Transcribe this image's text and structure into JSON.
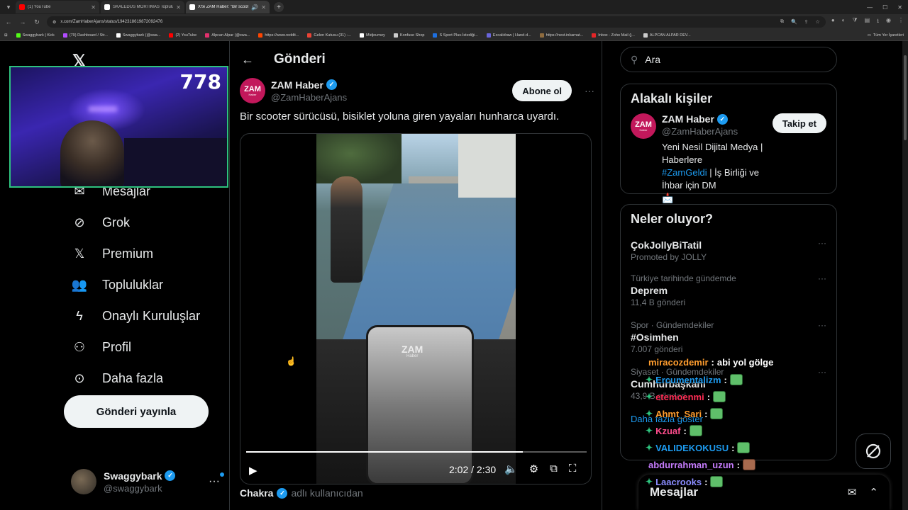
{
  "browser": {
    "tabs": [
      {
        "title": "(1) YouTube",
        "fav": "#ff0000",
        "active": false
      },
      {
        "title": "SKALEDUS MORTIMAS Topluluk",
        "fav": "#ffffff",
        "active": false
      },
      {
        "title": "X'te ZAM Haber: \"Bir scoot",
        "fav": "#ffffff",
        "active": true
      }
    ],
    "url": "x.com/ZamHaberAjans/status/1942318619872092476",
    "bookmarks": [
      {
        "label": "Swaggybark | Kick",
        "color": "#53fc18"
      },
      {
        "label": "(79) Dashboard / Str...",
        "color": "#b14cff"
      },
      {
        "label": "Swaggybark (@swa...",
        "color": "#ffffff"
      },
      {
        "label": "(2) YouTube",
        "color": "#ff0000"
      },
      {
        "label": "Alpcan Alpar (@swa...",
        "color": "#e1306c"
      },
      {
        "label": "https://www.reddit...",
        "color": "#ff4500"
      },
      {
        "label": "Gelen Kutusu (31) -...",
        "color": "#ea4335"
      },
      {
        "label": "Midjourney",
        "color": "#ffffff"
      },
      {
        "label": "Konfuse Shop",
        "color": "#cccccc"
      },
      {
        "label": "S Sport Plus-İstediği...",
        "color": "#1d6fe0"
      },
      {
        "label": "Excalidraw | Hand-d...",
        "color": "#6965db"
      },
      {
        "label": "https://nest.inkarnat...",
        "color": "#8e6b3e"
      },
      {
        "label": "Inbox - Zoho Mail (j...",
        "color": "#e42527"
      },
      {
        "label": "ALPCAN ALPAR DEV...",
        "color": "#cccccc"
      }
    ],
    "all_bookmarks": "Tüm Yer İşaretleri"
  },
  "webcam": {
    "count": "778"
  },
  "nav": {
    "items": [
      {
        "label": "Mesajlar",
        "icon": "envelope-icon"
      },
      {
        "label": "Grok",
        "icon": "grok-icon"
      },
      {
        "label": "Premium",
        "icon": "x-logo-icon"
      },
      {
        "label": "Topluluklar",
        "icon": "people-icon"
      },
      {
        "label": "Onaylı Kuruluşlar",
        "icon": "lightning-icon"
      },
      {
        "label": "Profil",
        "icon": "person-icon"
      },
      {
        "label": "Daha fazla",
        "icon": "more-circle-icon"
      }
    ],
    "post_button": "Gönderi yayınla",
    "account": {
      "name": "Swaggybark",
      "handle": "@swaggybark"
    }
  },
  "main": {
    "title": "Gönderi",
    "author": {
      "name": "ZAM Haber",
      "handle": "@ZamHaberAjans",
      "avatar_text": "ZAM",
      "avatar_sub": "Haber"
    },
    "subscribe": "Abone ol",
    "text": "Bir scooter sürücüsü, bisiklet yoluna giren yayaları hunharca uyardı.",
    "video": {
      "time": "2:02 / 2:30",
      "progress": 0.8133,
      "watermark": "ZAM",
      "watermark_sub": "Haber"
    },
    "community": {
      "name": "Chakra",
      "suffix": "adlı kullanıcıdan"
    }
  },
  "right": {
    "search_placeholder": "Ara",
    "related_title": "Alakalı kişiler",
    "related": {
      "name": "ZAM Haber",
      "handle": "@ZamHaberAjans",
      "follow": "Takip et",
      "bio_1": "Yeni Nesil Dijital Medya | Haberlere",
      "bio_tag": "#ZamGeldi",
      "bio_2": " | İş Birliği ve İhbar için DM",
      "bio_3": "📩"
    },
    "trends_title": "Neler oluyor?",
    "trends": [
      {
        "cat": "",
        "name": "ÇokJollyBiTatil",
        "meta": "Promoted by JOLLY"
      },
      {
        "cat": "Türkiye tarihinde gündemde",
        "name": "Deprem",
        "meta": "11,4 B gönderi"
      },
      {
        "cat": "Spor · Gündemdekiler",
        "name": "#Osimhen",
        "meta": "7.007 gönderi"
      },
      {
        "cat": "Siyaset · Gündemdekiler",
        "name": "Cumhurbaşkanı",
        "meta": "43,9 B gönderi"
      }
    ],
    "show_more": "Daha fazla göster",
    "messages_drawer": "Mesajlar"
  },
  "chat": [
    {
      "user": "miracozdemir",
      "color": "#ff9d2e",
      "msg": "abi yol gölge",
      "badge": false,
      "emote": ""
    },
    {
      "user": "Ercumentalizm",
      "color": "#1d9bf0",
      "msg": "",
      "badge": true,
      "emote": "green"
    },
    {
      "user": "etemoenmi",
      "color": "#ff2d55",
      "msg": "",
      "badge": true,
      "emote": "green"
    },
    {
      "user": "Ahmt_Sari",
      "color": "#ff9d2e",
      "msg": "",
      "badge": true,
      "emote": "green"
    },
    {
      "user": "Kzuaf",
      "color": "#ff4d8d",
      "msg": "",
      "badge": true,
      "emote": "green"
    },
    {
      "user": "VALIDEKOKUSU",
      "color": "#1d9bf0",
      "msg": "",
      "badge": true,
      "emote": "green"
    },
    {
      "user": "abdurrahman_uzun",
      "color": "#c77dff",
      "msg": "",
      "badge": false,
      "emote": "brown"
    },
    {
      "user": "Laacrooks",
      "color": "#8a8cff",
      "msg": "",
      "badge": true,
      "emote": "green"
    }
  ]
}
